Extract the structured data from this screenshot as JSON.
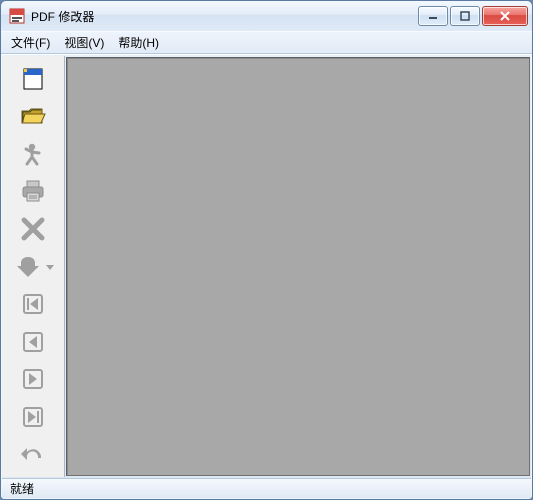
{
  "window": {
    "title": "PDF 修改器"
  },
  "menu": {
    "file": "文件(F)",
    "view": "视图(V)",
    "help": "帮助(H)"
  },
  "toolbar": {
    "items": [
      {
        "name": "new-doc",
        "enabled": true
      },
      {
        "name": "open-folder",
        "enabled": true
      },
      {
        "name": "run",
        "enabled": false
      },
      {
        "name": "print",
        "enabled": false
      },
      {
        "name": "delete",
        "enabled": false
      },
      {
        "name": "download",
        "enabled": false,
        "has_dropdown": true
      },
      {
        "name": "first-page",
        "enabled": false
      },
      {
        "name": "prev-page",
        "enabled": false
      },
      {
        "name": "next-page",
        "enabled": false
      },
      {
        "name": "last-page",
        "enabled": false
      },
      {
        "name": "undo",
        "enabled": false
      }
    ]
  },
  "status": {
    "text": "就绪"
  }
}
